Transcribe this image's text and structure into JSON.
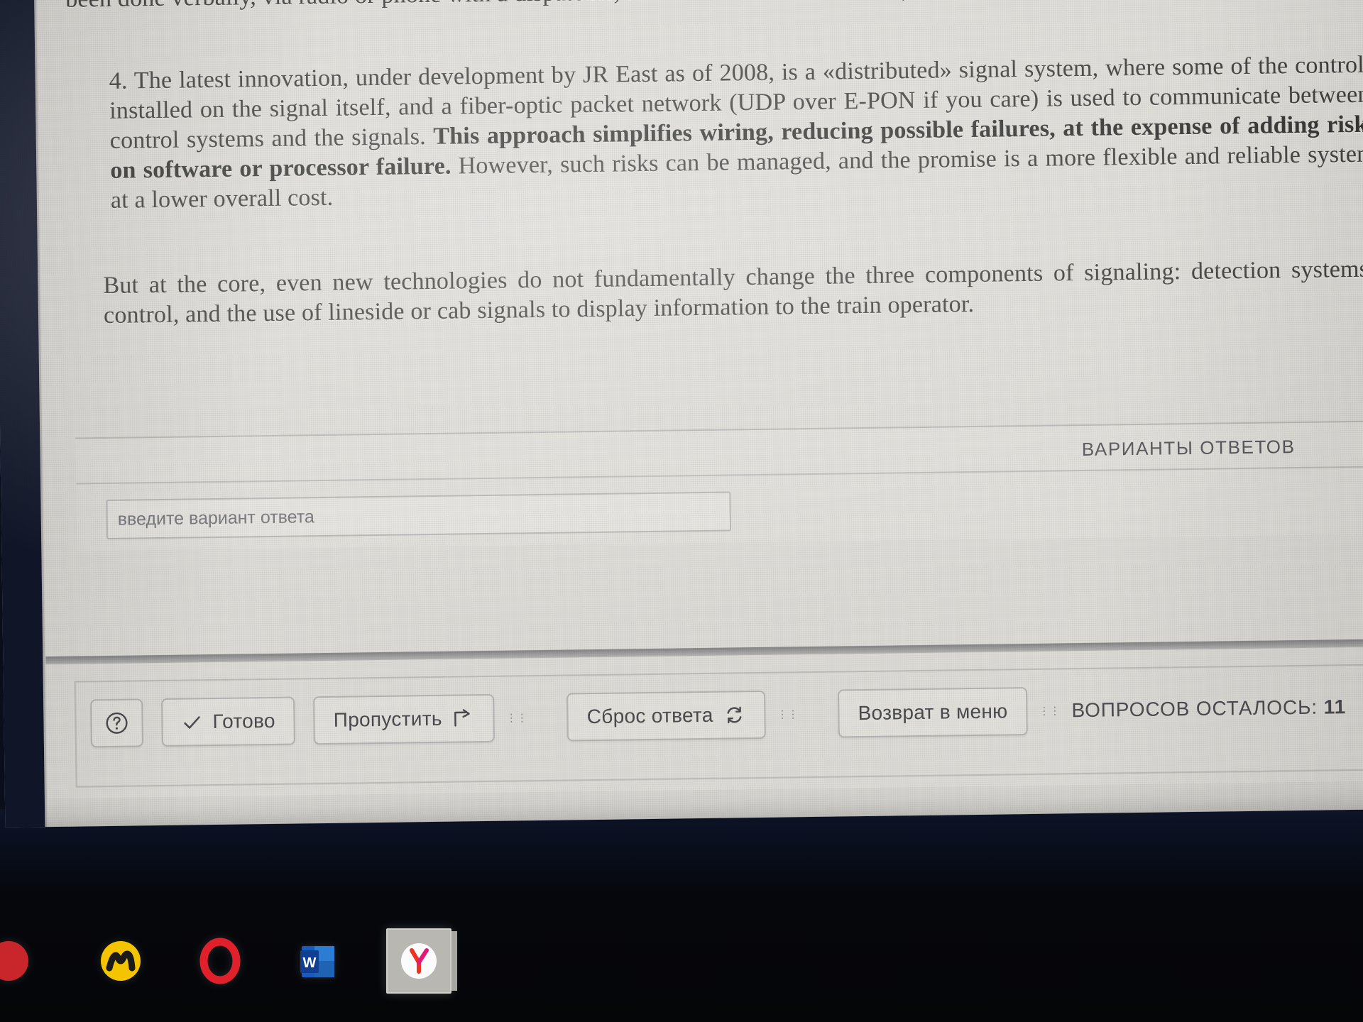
{
  "window": {
    "passage_top": "been done verbally, via radio or phone with a dispatcher, and mistakes could be made).",
    "paragraph_4_part1": "4. The latest innovation, under development by JR East as of 2008, is a «distributed» signal system, where some of the control logic is installed on the signal itself, and a fiber-optic packet network (UDP over E-PON if you care) is used to communicate between central control systems and the signals. ",
    "paragraph_4_bold": "This approach simplifies wiring, reducing possible failures, at the expense of adding risks based on software or processor failure.",
    "paragraph_4_part2": " However, such risks can be managed, and the promise is a more flexible and reliable system, likely at a lower overall cost.",
    "paragraph_core": "But at the core, even new technologies do not fundamentally change the three components of signaling: detection systems, central control, and the use of lineside or cab signals to display information to the train operator."
  },
  "answers": {
    "header": "ВАРИАНТЫ ОТВЕТОВ",
    "input_placeholder": "введите вариант ответа",
    "input_value": ""
  },
  "toolbar": {
    "help_label": "?",
    "done_label": "Готово",
    "skip_label": "Пропустить",
    "reset_label": "Сброс ответа",
    "back_to_menu_label": "Возврат в меню",
    "questions_left_label": "ВОПРОСОВ ОСТАЛОСЬ:",
    "questions_left_count": "11"
  },
  "taskbar": {
    "items": [
      {
        "name": "app-partial-red",
        "glyph": "",
        "color": "#c8262a"
      },
      {
        "name": "app-yellow-mark",
        "glyph": "m",
        "color": "#f5c400"
      },
      {
        "name": "opera-browser",
        "glyph": "O",
        "color": "#e0202a"
      },
      {
        "name": "microsoft-word",
        "glyph": "W",
        "color": "#2b579a"
      },
      {
        "name": "yandex-browser",
        "glyph": "Y",
        "color": "#ef3124"
      }
    ]
  },
  "colors": {
    "screen_bg": "#dedcd7",
    "text": "#3a3b38",
    "muted_text": "#55565a",
    "bezel": "#0a0e1b",
    "taskbar": "#07080d"
  }
}
